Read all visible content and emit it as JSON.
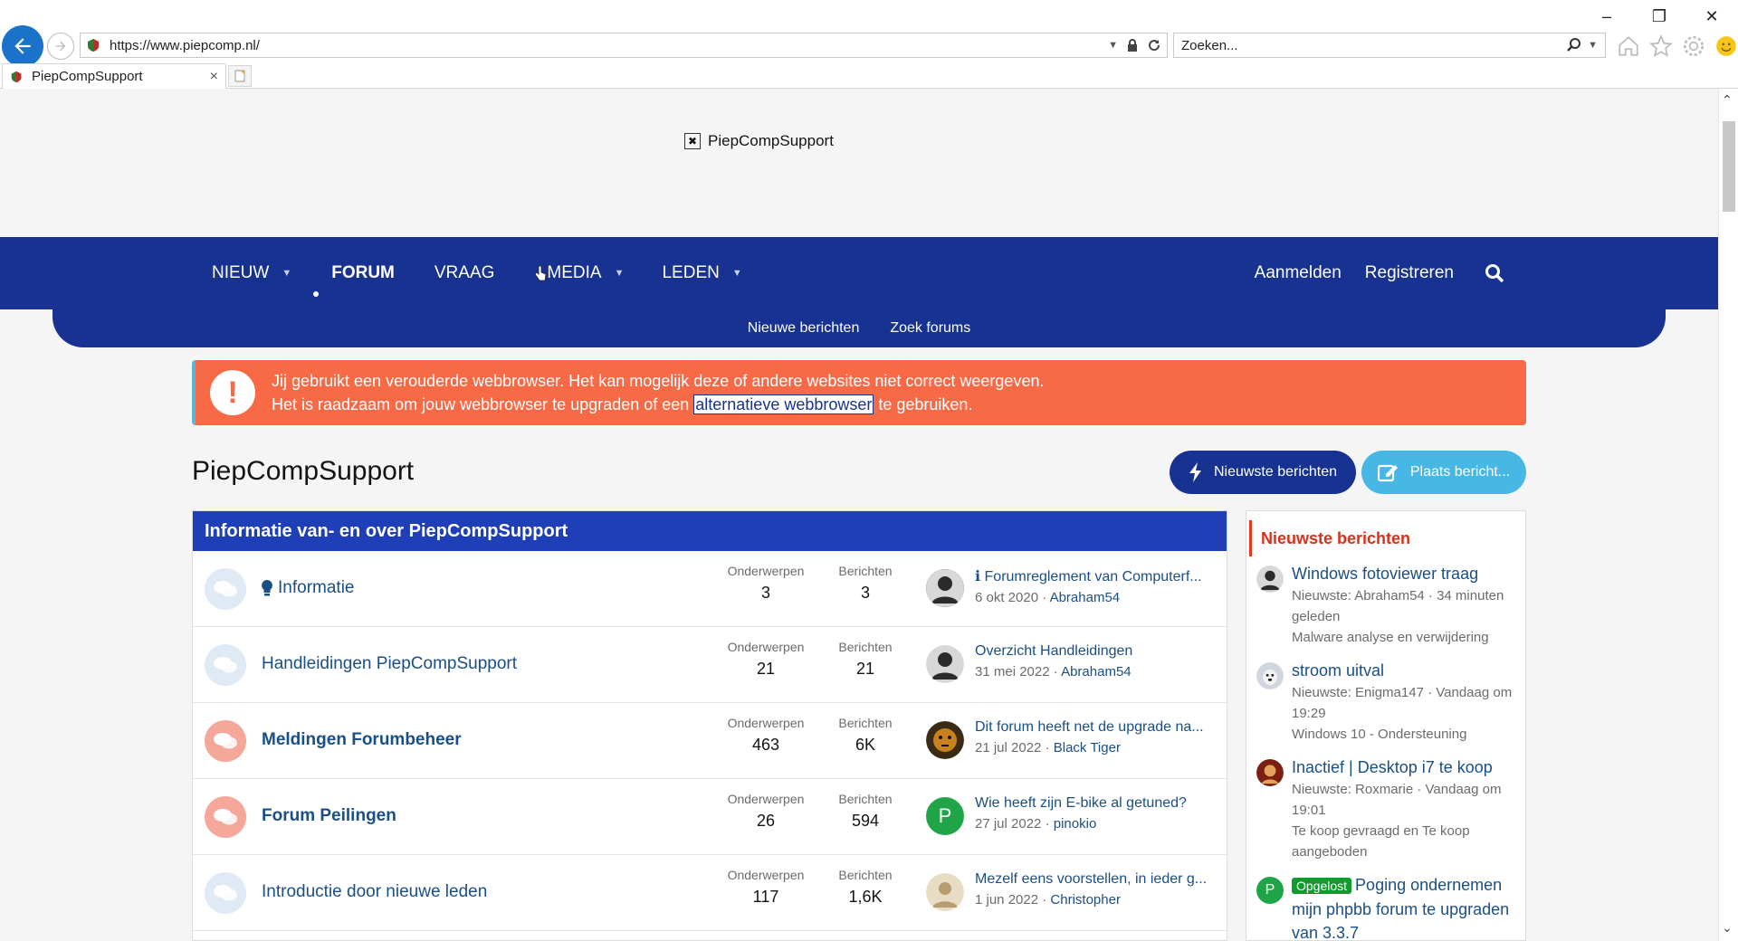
{
  "browser": {
    "url": "https://www.piepcomp.nl/",
    "search_placeholder": "Zoeken...",
    "tab_title": "PiepCompSupport",
    "tab_close": "×"
  },
  "site": {
    "logo_text": "PiepCompSupport",
    "nav": {
      "items": [
        {
          "label": "NIEUW",
          "has_caret": true
        },
        {
          "label": "FORUM",
          "active": true
        },
        {
          "label": "VRAAG"
        },
        {
          "label": "MEDIA",
          "has_caret": true
        },
        {
          "label": "LEDEN",
          "has_caret": true
        }
      ],
      "login": "Aanmelden",
      "register": "Registreren"
    },
    "subnav": [
      "Nieuwe berichten",
      "Zoek forums"
    ]
  },
  "notice": {
    "line1": "Jij gebruikt een verouderde webbrowser. Het kan mogelijk deze of andere websites niet correct weergeven.",
    "line2_before": "Het is raadzaam om jouw webbrowser te upgraden of een ",
    "line2_link": "alternatieve webbrowser",
    "line2_after": " te gebruiken."
  },
  "page": {
    "title": "PiepCompSupport",
    "btn_new": "Nieuwste berichten",
    "btn_post": "Plaats bericht..."
  },
  "forum": {
    "header": "Informatie van- en over PiepCompSupport",
    "label_topics": "Onderwerpen",
    "label_posts": "Berichten",
    "rows": [
      {
        "title": "Informatie",
        "topics": "3",
        "posts": "3",
        "last_title": "ℹ Forumreglement van Computerf...",
        "last_date": "6 okt 2020",
        "last_user": "Abraham54"
      },
      {
        "title": "Handleidingen PiepCompSupport",
        "topics": "21",
        "posts": "21",
        "last_title": "Overzicht Handleidingen",
        "last_date": "31 mei 2022",
        "last_user": "Abraham54"
      },
      {
        "title": "Meldingen Forumbeheer",
        "topics": "463",
        "posts": "6K",
        "last_title": "Dit forum heeft net de upgrade na...",
        "last_date": "21 jul 2022",
        "last_user": "Black Tiger"
      },
      {
        "title": "Forum Peilingen",
        "topics": "26",
        "posts": "594",
        "last_title": "Wie heeft zijn E-bike al getuned?",
        "last_date": "27 jul 2022",
        "last_user": "pinokio",
        "avatar_letter": "P"
      },
      {
        "title": "Introductie door nieuwe leden",
        "topics": "117",
        "posts": "1,6K",
        "last_title": "Mezelf eens voorstellen, in ieder g...",
        "last_date": "1 jun 2022",
        "last_user": "Christopher"
      }
    ]
  },
  "sidebar": {
    "heading": "Nieuwste berichten",
    "items": [
      {
        "title": "Windows fotoviewer traag",
        "meta": "Nieuwste: Abraham54 · 34 minuten geleden",
        "forum": "Malware analyse en verwijdering"
      },
      {
        "title": "stroom uitval",
        "meta": "Nieuwste: Enigma147 · Vandaag om 19:29",
        "forum": "Windows 10 - Ondersteuning"
      },
      {
        "title": "Inactief | Desktop i7 te koop",
        "meta": "Nieuwste: Roxmarie · Vandaag om 19:01",
        "forum": "Te koop gevraagd en Te koop aangeboden"
      },
      {
        "badge": "Opgelost",
        "title": "Poging ondernemen mijn phpbb forum te upgraden van 3.3.7",
        "avatar_letter": "P"
      }
    ]
  },
  "colors": {
    "nav_bg": "#173291",
    "notice_bg": "#f86a46",
    "header_bg": "#1e3fb8",
    "link": "#1a4f85",
    "accent_red": "#d8301b",
    "solved_green": "#119b2e"
  }
}
